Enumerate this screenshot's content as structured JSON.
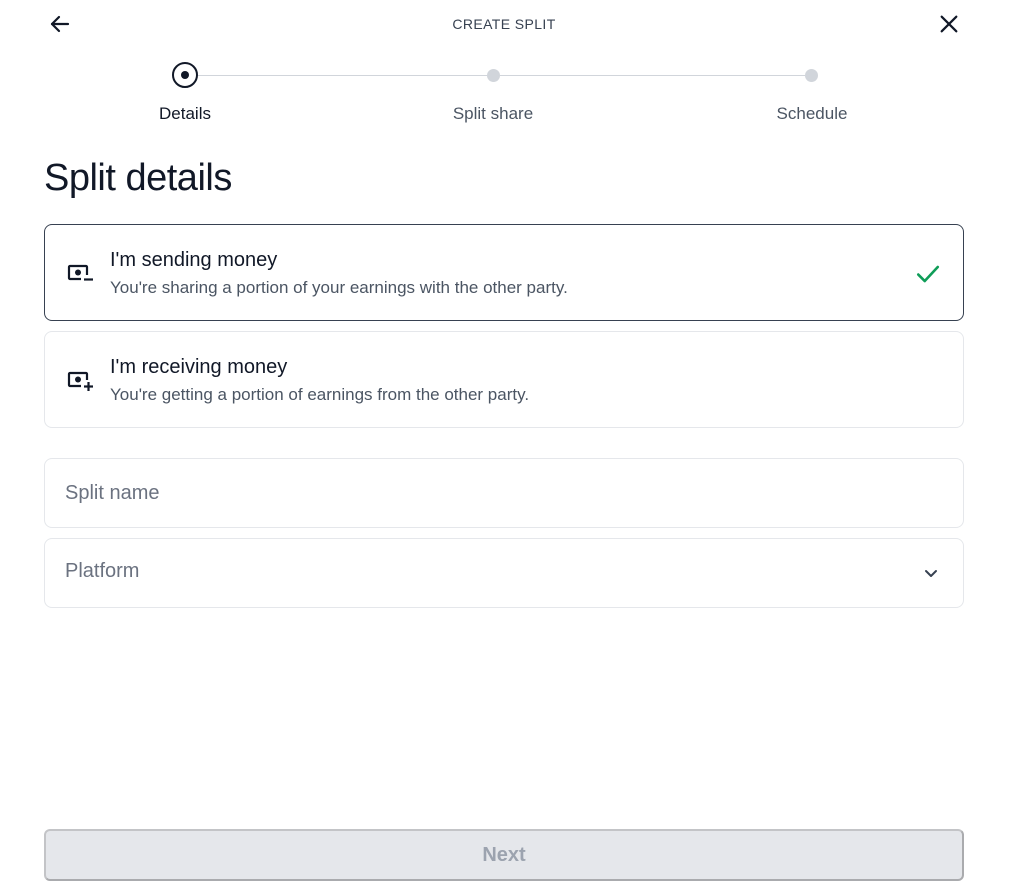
{
  "header": {
    "title": "CREATE SPLIT",
    "back_icon": "arrow-left-icon",
    "close_icon": "close-icon"
  },
  "stepper": {
    "steps": [
      {
        "label": "Details",
        "state": "active"
      },
      {
        "label": "Split share",
        "state": "upcoming"
      },
      {
        "label": "Schedule",
        "state": "upcoming"
      }
    ]
  },
  "page": {
    "title": "Split details"
  },
  "options": [
    {
      "title": "I'm sending money",
      "description": "You're sharing a portion of your earnings with the other party.",
      "icon": "money-minus-icon",
      "selected": true
    },
    {
      "title": "I'm receiving money",
      "description": "You're getting a portion of earnings from the other party.",
      "icon": "money-plus-icon",
      "selected": false
    }
  ],
  "form": {
    "split_name": {
      "placeholder": "Split name",
      "value": ""
    },
    "platform": {
      "placeholder": "Platform",
      "value": ""
    }
  },
  "footer": {
    "next_label": "Next",
    "next_enabled": false
  },
  "colors": {
    "accent_check": "#0f9d58",
    "primary_text": "#111827",
    "secondary_text": "#4b5563",
    "border": "#e5e7eb",
    "disabled_bg": "#e5e7eb",
    "disabled_text": "#9ca3af"
  }
}
